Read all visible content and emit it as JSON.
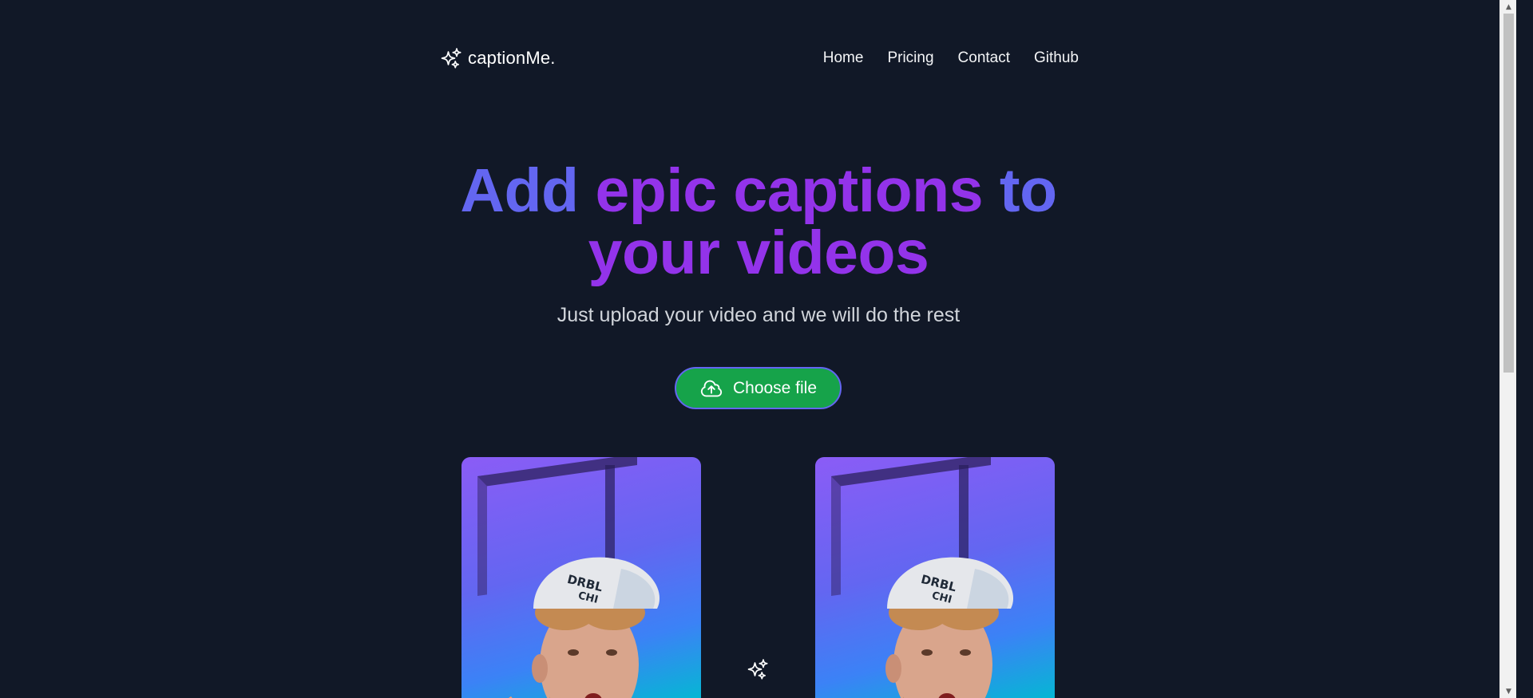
{
  "header": {
    "brand_name": "captionMe.",
    "brand_icon": "sparkles-icon",
    "nav": [
      {
        "label": "Home"
      },
      {
        "label": "Pricing"
      },
      {
        "label": "Contact"
      },
      {
        "label": "Github"
      }
    ]
  },
  "hero": {
    "title_part1": "Add ",
    "title_part2": "epic captions",
    "title_part3": " to",
    "title_line2": "your videos",
    "subtitle": "Just upload your video and we will do the rest"
  },
  "upload": {
    "label": "Choose file",
    "icon": "cloud-upload-icon"
  },
  "colors": {
    "background": "#111827",
    "accent_blue": "#6366f1",
    "accent_purple": "#9333ea",
    "button_green": "#16a34a"
  },
  "previews": {
    "left": "video-preview-original",
    "right": "video-preview-captioned",
    "divider_icon": "sparkles-icon"
  }
}
